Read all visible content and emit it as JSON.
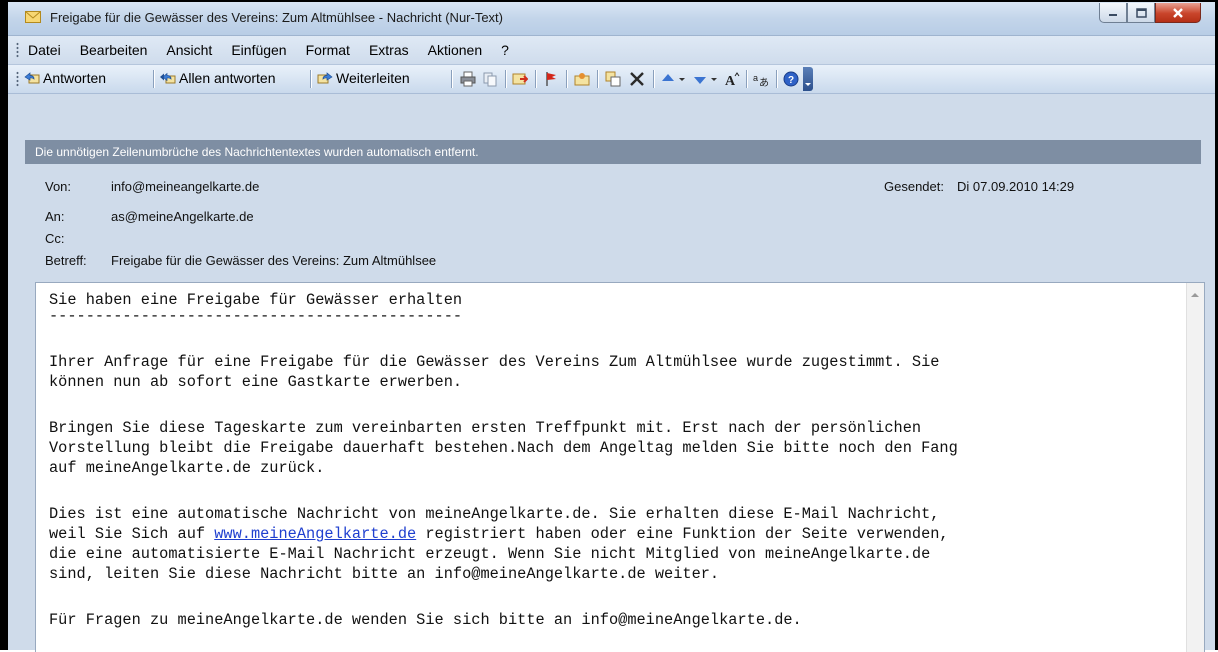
{
  "window": {
    "title": "Freigabe für die Gewässer des Vereins: Zum Altmühlsee - Nachricht (Nur-Text)"
  },
  "menu": [
    "Datei",
    "Bearbeiten",
    "Ansicht",
    "Einfügen",
    "Format",
    "Extras",
    "Aktionen",
    "?"
  ],
  "toolbar": {
    "reply": "Antworten",
    "reply_all": "Allen antworten",
    "forward": "Weiterleiten"
  },
  "infobar": {
    "text": "Die unnötigen Zeilenumbrüche des Nachrichtentextes wurden automatisch entfernt."
  },
  "header": {
    "from_label": "Von:",
    "from_value": "info@meineangelkarte.de",
    "sent_label": "Gesendet:",
    "sent_value": "Di 07.09.2010 14:29",
    "to_label": "An:",
    "to_value": "as@meineAngelkarte.de",
    "cc_label": "Cc:",
    "subject_label": "Betreff:",
    "subject_value": "Freigabe für die Gewässer des Vereins: Zum Altmühlsee"
  },
  "body": {
    "heading": "Sie haben eine Freigabe für Gewässer erhalten",
    "rule": "---------------------------------------------",
    "p1_l1": "Ihrer Anfrage für eine Freigabe für die Gewässer des Vereins Zum Altmühlsee wurde zugestimmt. Sie",
    "p1_l2": "können nun ab sofort eine Gastkarte erwerben.",
    "p2_l1": "Bringen Sie diese Tageskarte zum vereinbarten ersten Treffpunkt mit. Erst nach der persönlichen",
    "p2_l2": "Vorstellung bleibt die Freigabe dauerhaft bestehen.Nach dem Angeltag melden Sie bitte noch den Fang",
    "p2_l3": "auf meineAngelkarte.de zurück.",
    "p3_l1": "Dies ist eine automatische Nachricht von meineAngelkarte.de. Sie erhalten diese E-Mail Nachricht,",
    "p3_l2_pre": "weil Sie Sich auf ",
    "p3_l2_link": "www.meineAngelkarte.de",
    "p3_l2_post": " registriert haben oder eine Funktion der Seite verwenden,",
    "p3_l3": "die eine automatisierte E-Mail Nachricht erzeugt. Wenn Sie nicht Mitglied von meineAngelkarte.de",
    "p3_l4": "sind, leiten Sie diese Nachricht bitte an info@meineAngelkarte.de weiter.",
    "p4_l1": "Für Fragen zu meineAngelkarte.de wenden Sie sich bitte an info@meineAngelkarte.de."
  }
}
